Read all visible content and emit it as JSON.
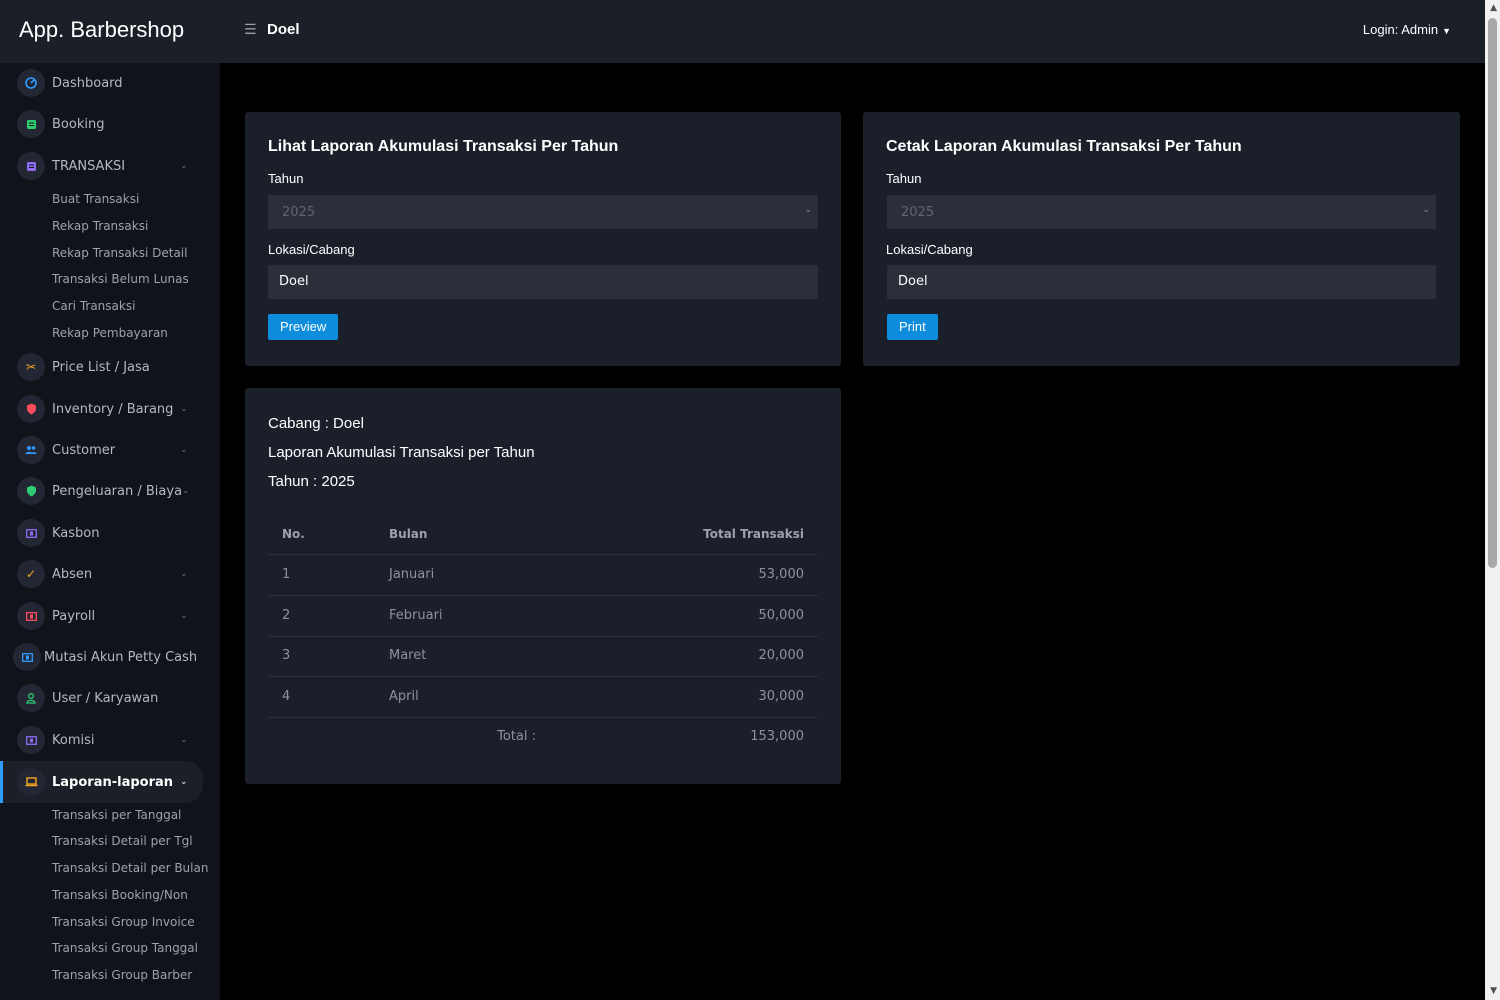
{
  "app": {
    "brand": "App. Barbershop",
    "page_title": "Doel",
    "login": "Login: Admin"
  },
  "sidebar": {
    "items": [
      {
        "label": "Dashboard",
        "icon": "dashboard-icon"
      },
      {
        "label": "Booking",
        "icon": "booking-icon"
      },
      {
        "label": "TRANSAKSI",
        "icon": "transaction-icon"
      },
      {
        "label": "Price List / Jasa",
        "icon": "scissors-icon"
      },
      {
        "label": "Inventory / Barang",
        "icon": "inventory-icon"
      },
      {
        "label": "Customer",
        "icon": "customer-icon"
      },
      {
        "label": "Pengeluaran / Biaya",
        "icon": "shield-icon"
      },
      {
        "label": "Kasbon",
        "icon": "kasbon-icon"
      },
      {
        "label": "Absen",
        "icon": "check-icon"
      },
      {
        "label": "Payroll",
        "icon": "payroll-icon"
      },
      {
        "label": "Mutasi Akun Petty Cash",
        "icon": "petty-cash-icon"
      },
      {
        "label": "User / Karyawan",
        "icon": "user-icon"
      },
      {
        "label": "Komisi",
        "icon": "komisi-icon"
      },
      {
        "label": "Laporan-laporan",
        "icon": "laptop-icon"
      }
    ],
    "transaksi_sub": [
      "Buat Transaksi",
      "Rekap Transaksi",
      "Rekap Transaksi Detail",
      "Transaksi Belum Lunas",
      "Cari Transaksi",
      "Rekap Pembayaran"
    ],
    "laporan_sub": [
      "Transaksi per Tanggal",
      "Transaksi Detail per Tgl",
      "Transaksi Detail per Bulan",
      "Transaksi Booking/Non",
      "Transaksi Group Invoice",
      "Transaksi Group Tanggal",
      "Transaksi Group Barber"
    ]
  },
  "view_card": {
    "title": "Lihat Laporan Akumulasi Transaksi Per Tahun",
    "year_label": "Tahun",
    "year_value": "2025",
    "location_label": "Lokasi/Cabang",
    "location_value": "Doel",
    "button": "Preview"
  },
  "print_card": {
    "title": "Cetak Laporan Akumulasi Transaksi Per Tahun",
    "year_label": "Tahun",
    "year_value": "2025",
    "location_label": "Lokasi/Cabang",
    "location_value": "Doel",
    "button": "Print"
  },
  "report": {
    "branch": "Cabang : Doel",
    "title": "Laporan Akumulasi Transaksi per Tahun",
    "year": "Tahun : 2025",
    "headers": {
      "no": "No.",
      "month": "Bulan",
      "total": "Total Transaksi"
    },
    "rows": [
      {
        "no": "1",
        "month": "Januari",
        "total": "53,000"
      },
      {
        "no": "2",
        "month": "Februari",
        "total": "50,000"
      },
      {
        "no": "3",
        "month": "Maret",
        "total": "20,000"
      },
      {
        "no": "4",
        "month": "April",
        "total": "30,000"
      }
    ],
    "total_label": "Total :",
    "total_value": "153,000"
  },
  "colors": {
    "accent": "#0d8ddb",
    "card_bg": "#1b1f29",
    "sidebar_bg": "#11131a"
  }
}
